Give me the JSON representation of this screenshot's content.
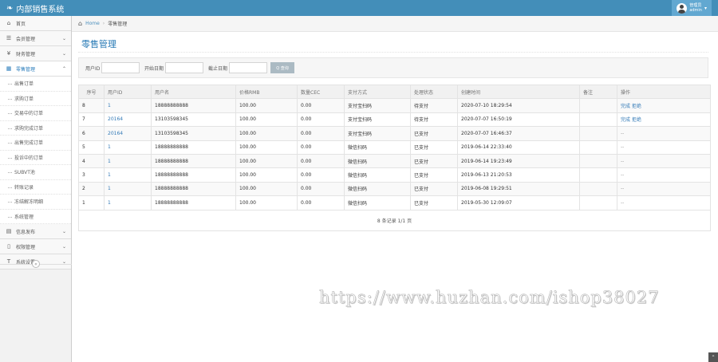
{
  "app": {
    "title": "内部销售系统"
  },
  "user": {
    "role": "管理员",
    "name": "admin"
  },
  "sidebar": {
    "items": [
      {
        "label": "首页",
        "icon": "dashboard-icon",
        "glyph": "⌂"
      },
      {
        "label": "会员管理",
        "icon": "users-icon",
        "glyph": "☰",
        "arrow": "⌄"
      },
      {
        "label": "财务管理",
        "icon": "money-icon",
        "glyph": "¥",
        "arrow": "⌄"
      },
      {
        "label": "零售管理",
        "icon": "calendar-icon",
        "glyph": "▦",
        "arrow": "⌃"
      }
    ],
    "sub_items": [
      "出售订单",
      "求购订单",
      "交易中的订单",
      "求购完成订单",
      "出售完成订单",
      "投诉中的订单",
      "SUBVT池",
      "转账记录",
      "冻结解冻明细",
      "系统管理"
    ],
    "bottom_items": [
      {
        "label": "信息发布",
        "icon": "news-icon",
        "glyph": "▤",
        "arrow": "⌄"
      },
      {
        "label": "权限管理",
        "icon": "file-icon",
        "glyph": "▯",
        "arrow": "⌄"
      },
      {
        "label": "系统设置",
        "icon": "text-icon",
        "glyph": "T",
        "arrow": "⌄"
      }
    ],
    "collapse_glyph": "«"
  },
  "breadcrumb": {
    "home": "Home",
    "current": "零售管理"
  },
  "page": {
    "title": "零售管理"
  },
  "search": {
    "user_id_label": "用户ID",
    "start_label": "开始日期",
    "end_label": "截止日期",
    "button_label": "Q 查询"
  },
  "table": {
    "headers": [
      "序号",
      "用户ID",
      "用户名",
      "价格RMB",
      "数量CEC",
      "支付方式",
      "处理状态",
      "创建时间",
      "备注",
      "操作"
    ],
    "rows": [
      {
        "no": "8",
        "uid": "1",
        "uname": "18888888888",
        "rmb": "100.00",
        "cec": "0.00",
        "pay": "支付宝扫码",
        "status": "待支付",
        "time": "2020-07-10 18:29:54",
        "note": "",
        "op": "完成 拒绝"
      },
      {
        "no": "7",
        "uid": "20164",
        "uname": "13103598345",
        "rmb": "100.00",
        "cec": "0.00",
        "pay": "支付宝扫码",
        "status": "待支付",
        "time": "2020-07-07 16:50:19",
        "note": "",
        "op": "完成 拒绝"
      },
      {
        "no": "6",
        "uid": "20164",
        "uname": "13103598345",
        "rmb": "100.00",
        "cec": "0.00",
        "pay": "支付宝扫码",
        "status": "已支付",
        "time": "2020-07-07 16:46:37",
        "note": "",
        "op": "--"
      },
      {
        "no": "5",
        "uid": "1",
        "uname": "18888888888",
        "rmb": "100.00",
        "cec": "0.00",
        "pay": "微信扫码",
        "status": "已支付",
        "time": "2019-06-14 22:33:40",
        "note": "",
        "op": "--"
      },
      {
        "no": "4",
        "uid": "1",
        "uname": "18888888888",
        "rmb": "100.00",
        "cec": "0.00",
        "pay": "微信扫码",
        "status": "已支付",
        "time": "2019-06-14 19:23:49",
        "note": "",
        "op": "--"
      },
      {
        "no": "3",
        "uid": "1",
        "uname": "18888888888",
        "rmb": "100.00",
        "cec": "0.00",
        "pay": "微信扫码",
        "status": "已支付",
        "time": "2019-06-13 21:20:53",
        "note": "",
        "op": "--"
      },
      {
        "no": "2",
        "uid": "1",
        "uname": "18888888888",
        "rmb": "100.00",
        "cec": "0.00",
        "pay": "微信扫码",
        "status": "已支付",
        "time": "2019-06-08 19:29:51",
        "note": "",
        "op": "--"
      },
      {
        "no": "1",
        "uid": "1",
        "uname": "18888888888",
        "rmb": "100.00",
        "cec": "0.00",
        "pay": "微信扫码",
        "status": "已支付",
        "time": "2019-05-30 12:09:07",
        "note": "",
        "op": "--"
      }
    ],
    "pager": "8 条记录 1/1 页"
  },
  "watermark": "https://www.huzhan.com/ishop38027",
  "scroll_top_glyph": "⌃",
  "colors": {
    "topbar": "#438eb9",
    "accent": "#2679b5",
    "link": "#337ab7"
  }
}
